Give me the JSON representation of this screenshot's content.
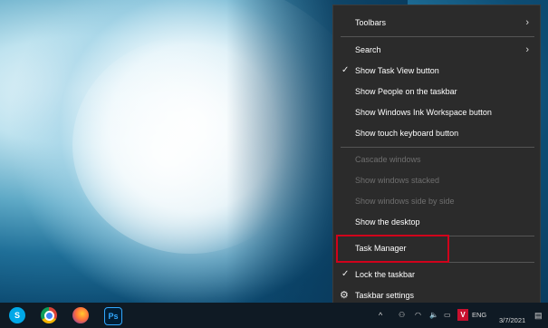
{
  "context_menu": {
    "items": [
      {
        "label": "Toolbars",
        "has_submenu": true,
        "enabled": true
      },
      {
        "label": "Search",
        "has_submenu": true,
        "enabled": true
      },
      {
        "label": "Show Task View button",
        "checked": true,
        "enabled": true
      },
      {
        "label": "Show People on the taskbar",
        "enabled": true
      },
      {
        "label": "Show Windows Ink Workspace button",
        "enabled": true
      },
      {
        "label": "Show touch keyboard button",
        "enabled": true
      },
      {
        "label": "Cascade windows",
        "enabled": false
      },
      {
        "label": "Show windows stacked",
        "enabled": false
      },
      {
        "label": "Show windows side by side",
        "enabled": false
      },
      {
        "label": "Show the desktop",
        "enabled": true
      },
      {
        "label": "Task Manager",
        "enabled": true,
        "highlighted": true
      },
      {
        "label": "Lock the taskbar",
        "checked": true,
        "enabled": true
      },
      {
        "label": "Taskbar settings",
        "icon": "gear-icon",
        "enabled": true
      }
    ],
    "chevron": "›",
    "checkmark": "✓",
    "gear": "⚙"
  },
  "taskbar": {
    "apps": [
      {
        "name": "skype-icon",
        "glyph": "S"
      },
      {
        "name": "chrome-icon",
        "glyph": ""
      },
      {
        "name": "firefox-icon",
        "glyph": ""
      },
      {
        "name": "photoshop-icon",
        "glyph": "Ps"
      }
    ],
    "tray": {
      "overflow_glyph": "^",
      "people_glyph": "⚇",
      "wifi_glyph": "◠",
      "volume_glyph": "🔈",
      "network_glyph": "▭",
      "app_badge": "V",
      "language": "ENG",
      "date": "3/7/2021",
      "notification_glyph": "▤"
    }
  },
  "colors": {
    "menu_bg": "#2b2b2b",
    "taskbar_bg": "#0f1a24",
    "highlight_border": "#d0021b"
  }
}
